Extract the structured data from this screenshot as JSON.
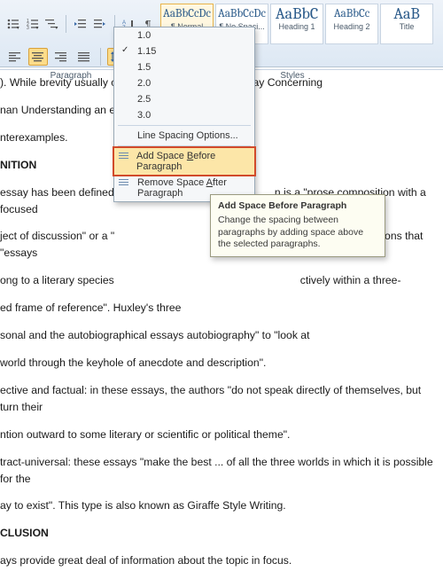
{
  "ribbon": {
    "group_paragraph": "Paragraph",
    "group_styles": "Styles",
    "styles": [
      {
        "sample": "AaBbCcDc",
        "label": "¶ Normal"
      },
      {
        "sample": "AaBbCcDc",
        "label": "¶ No Spaci..."
      },
      {
        "sample": "AaBbC",
        "label": "Heading 1"
      },
      {
        "sample": "AaBbCc",
        "label": "Heading 2"
      },
      {
        "sample": "AaB",
        "label": "Title"
      }
    ]
  },
  "line_spacing_menu": {
    "values": [
      "1.0",
      "1.15",
      "1.5",
      "2.0",
      "2.5",
      "3.0"
    ],
    "checked_index": 1,
    "options_label": "Line Spacing Options...",
    "add_before": {
      "pre": "Add Space ",
      "u": "B",
      "post": "efore Paragraph"
    },
    "remove_after": {
      "pre": "Remove Space ",
      "u": "A",
      "post": "fter Paragraph"
    }
  },
  "tooltip": {
    "title": "Add Space Before Paragraph",
    "body": "Change the spacing between paragraphs by adding space above the selected paragraphs."
  },
  "document": {
    "p1": "). While brevity usually                                                       orks like John Locke's An Essay Concerning",
    "p2": "nan Understanding an                                                       e Principle of Population are",
    "p3": "nterexamples.",
    "h1": "NITION",
    "p4a": "essay has been defined i",
    "p4b": "n is a \"prose composition with a focused",
    "p5a": "ject of discussion\" or a \"",
    "p5b": "argues on several occasions that \"essays",
    "p6a": "ong to a literary species",
    "p6b": "ctively within a three-",
    "p7": "ed frame of reference\". Huxley's three",
    "p8": "sonal and the autobiographical essays                                             autobiography\" to \"look at",
    "p9": "world through the keyhole of anecdote and description\".",
    "p10": "ective and factual: in these essays, the authors \"do not speak directly of themselves, but turn their",
    "p11": "ntion outward to some literary or scientific or political theme\".",
    "p12": "tract-universal: these essays \"make the best ... of all the three worlds in which it is possible for the",
    "p13": "ay to exist\". This type is also known as Giraffe Style Writing.",
    "h2": "CLUSION",
    "p14": "ays provide great deal of information about the topic in focus."
  }
}
